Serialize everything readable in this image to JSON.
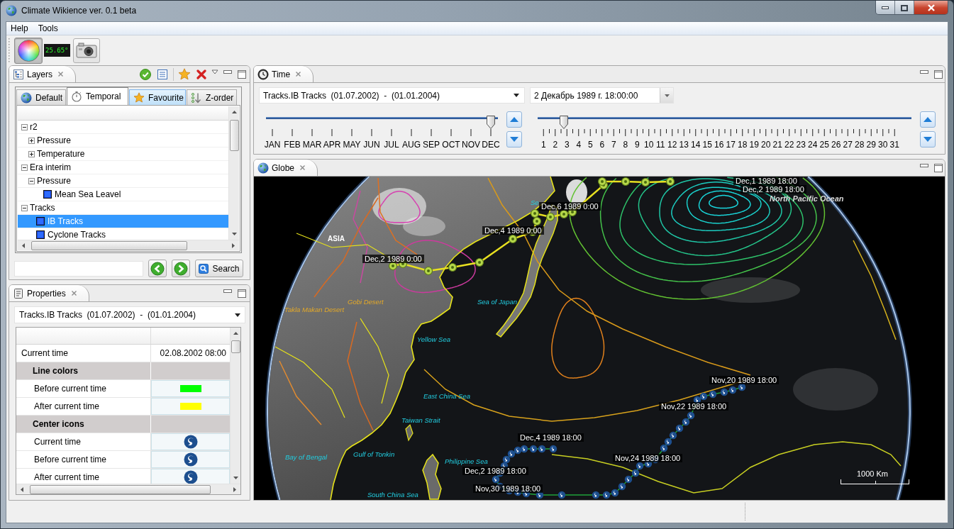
{
  "window": {
    "title": "Climate Wikience ver. 0.1 beta"
  },
  "menu": [
    "Help",
    "Tools"
  ],
  "toolbar": {
    "temperature": "25.65°"
  },
  "layers_panel": {
    "title": "Layers",
    "tabs": [
      {
        "label": "Default",
        "selected": false,
        "hovered": false
      },
      {
        "label": "Temporal",
        "selected": true,
        "hovered": false
      },
      {
        "label": "Favourite",
        "selected": false,
        "hovered": true
      },
      {
        "label": "Z-order",
        "selected": false,
        "hovered": false
      }
    ],
    "tree": [
      {
        "label": "r2",
        "kind": "group",
        "expanded": true,
        "selected": false,
        "children": [
          {
            "label": "Pressure",
            "kind": "group",
            "expanded": false,
            "selected": false
          },
          {
            "label": "Temperature",
            "kind": "group",
            "expanded": false,
            "selected": false
          }
        ]
      },
      {
        "label": "Era interim",
        "kind": "group",
        "expanded": true,
        "selected": false,
        "children": [
          {
            "label": "Pressure",
            "kind": "group",
            "expanded": true,
            "selected": false,
            "children": [
              {
                "label": "Mean Sea Leavel",
                "kind": "layer",
                "selected": false
              }
            ]
          }
        ]
      },
      {
        "label": "Tracks",
        "kind": "group",
        "expanded": true,
        "selected": false,
        "children": [
          {
            "label": "IB Tracks",
            "kind": "layer",
            "selected": true
          },
          {
            "label": "Cyclone Tracks",
            "kind": "layer",
            "selected": false
          }
        ]
      }
    ],
    "search_button": "Search"
  },
  "properties_panel": {
    "title": "Properties",
    "layer_selector": "Tracks.IB Tracks  (01.07.2002)  -  (01.01.2004)",
    "rows": [
      {
        "kind": "value",
        "name": "Current time",
        "value": "02.08.2002 08:00"
      },
      {
        "kind": "group",
        "name": "Line colors"
      },
      {
        "kind": "color",
        "name": "Before current time",
        "color": "#00ff00"
      },
      {
        "kind": "color",
        "name": "After current time",
        "color": "#ffff00"
      },
      {
        "kind": "group",
        "name": "Center icons"
      },
      {
        "kind": "icon",
        "name": "Current time"
      },
      {
        "kind": "icon",
        "name": "Before current time"
      },
      {
        "kind": "icon",
        "name": "After current time"
      }
    ]
  },
  "time_panel": {
    "title": "Time",
    "layer_selector": "Tracks.IB Tracks  (01.07.2002)  -  (01.01.2004)",
    "date_field": "2 Декабрь 1989 г. 18:00:00",
    "month_slider": {
      "level": 1,
      "labels": [
        "JAN",
        "FEB",
        "MAR",
        "APR",
        "MAY",
        "JUN",
        "JUL",
        "AUG",
        "SEP",
        "OCT",
        "NOV",
        "DEC"
      ]
    },
    "day_slider": {
      "level": 0.058,
      "labels": [
        "1",
        "2",
        "3",
        "4",
        "5",
        "6",
        "7",
        "8",
        "9",
        "10",
        "11",
        "12",
        "13",
        "14",
        "15",
        "16",
        "17",
        "18",
        "19",
        "20",
        "21",
        "22",
        "23",
        "24",
        "25",
        "26",
        "27",
        "28",
        "29",
        "30",
        "31"
      ]
    }
  },
  "globe_panel": {
    "title": "Globe",
    "place_labels": [
      {
        "text": "North Pacific Ocean",
        "kind": "ocean"
      },
      {
        "text": "Se",
        "kind": "sea"
      },
      {
        "text": "ASIA",
        "kind": "continent"
      },
      {
        "text": "Gobi Desert",
        "kind": "desert"
      },
      {
        "text": "Sea of Japan",
        "kind": "sea"
      },
      {
        "text": "Takla Makan Desert",
        "kind": "desert"
      },
      {
        "text": "Yellow Sea",
        "kind": "sea"
      },
      {
        "text": "East China Sea",
        "kind": "sea"
      },
      {
        "text": "Taiwan Strait",
        "kind": "sea"
      },
      {
        "text": "Gulf of Tonkin",
        "kind": "sea"
      },
      {
        "text": "Bay of Bengal",
        "kind": "sea"
      },
      {
        "text": "Philippine Sea",
        "kind": "sea"
      },
      {
        "text": "South China Sea",
        "kind": "sea"
      }
    ],
    "track_labels": [
      "Dec,1 1989 18:00",
      "Dec,2 1989 18:00",
      "Dec,6 1989 0:00",
      "Dec,4 1989 0:00",
      "Dec,2 1989 0:00",
      "Nov,20 1989 18:00",
      "Nov,22 1989 18:00",
      "Dec,4 1989 18:00",
      "Nov,24 1989 18:00",
      "Dec,2 1989 18:00",
      "Nov,30 1989 18:00"
    ],
    "scale_label": "1000 Km"
  }
}
